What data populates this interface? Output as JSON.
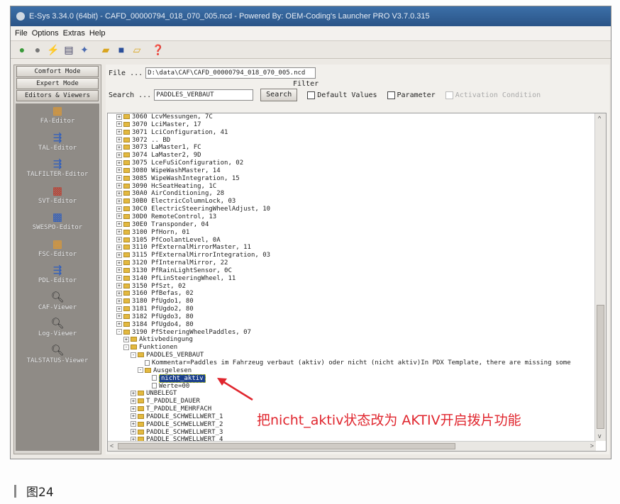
{
  "titlebar": {
    "text": "E-Sys 3.34.0  (64bit) - CAFD_00000794_018_070_005.ncd  - Powered By: OEM-Coding's Launcher PRO V3.7.0.315"
  },
  "menu": [
    "File",
    "Options",
    "Extras",
    "Help"
  ],
  "toolbar_icons": [
    "connect-icon",
    "disconnect-icon",
    "flash-icon",
    "document-icon",
    "settings-icon",
    "open-folder-icon",
    "save-icon",
    "export-icon",
    "help-icon"
  ],
  "sidebar": {
    "modes": [
      "Comfort Mode",
      "Expert Mode",
      "Editors & Viewers"
    ],
    "tools": [
      "FA-Editor",
      "TAL-Editor",
      "TALFILTER-Editor",
      "SVT-Editor",
      "SWESPO-Editor",
      "FSC-Editor",
      "PDL-Editor",
      "CAF-Viewer",
      "Log-Viewer",
      "TALSTATUS-Viewer"
    ]
  },
  "file": {
    "label": "File ...",
    "value": "D:\\data\\CAF\\CAFD_00000794_018_070_005.ncd"
  },
  "filter": {
    "label": "Filter"
  },
  "search": {
    "label": "Search ...",
    "value": "PADDLES_VERBAUT",
    "button": "Search",
    "default_values": "Default Values",
    "parameter": "Parameter",
    "activation_condition": "Activation Condition"
  },
  "tree": [
    {
      "indent": 0,
      "text": "3060 LcvMessungen, 7C",
      "type": "folder",
      "exp": "+"
    },
    {
      "indent": 0,
      "text": "3070 LciMaster, 17",
      "type": "folder",
      "exp": "+"
    },
    {
      "indent": 0,
      "text": "3071 LciConfiguration, 41",
      "type": "folder",
      "exp": "+"
    },
    {
      "indent": 0,
      "text": "3072 .. BD",
      "type": "folder",
      "exp": "+"
    },
    {
      "indent": 0,
      "text": "3073 LaMaster1, FC",
      "type": "folder",
      "exp": "+"
    },
    {
      "indent": 0,
      "text": "3074 LaMaster2, 9D",
      "type": "folder",
      "exp": "+"
    },
    {
      "indent": 0,
      "text": "3075 LceFuSiConfiguration, 02",
      "type": "folder",
      "exp": "+"
    },
    {
      "indent": 0,
      "text": "3080 WipeWashMaster, 14",
      "type": "folder",
      "exp": "+"
    },
    {
      "indent": 0,
      "text": "3085 WipeWashIntegration, 15",
      "type": "folder",
      "exp": "+"
    },
    {
      "indent": 0,
      "text": "3090 HcSeatHeating, 1C",
      "type": "folder",
      "exp": "+"
    },
    {
      "indent": 0,
      "text": "30A0 AirConditioning, 28",
      "type": "folder",
      "exp": "+"
    },
    {
      "indent": 0,
      "text": "30B0 ElectricColumnLock, 03",
      "type": "folder",
      "exp": "+"
    },
    {
      "indent": 0,
      "text": "30C0 ElectricSteeringWheelAdjust, 10",
      "type": "folder",
      "exp": "+"
    },
    {
      "indent": 0,
      "text": "30D0 RemoteControl, 13",
      "type": "folder",
      "exp": "+"
    },
    {
      "indent": 0,
      "text": "30E0 Transponder, 04",
      "type": "folder",
      "exp": "+"
    },
    {
      "indent": 0,
      "text": "3100 PfHorn, 01",
      "type": "folder",
      "exp": "+"
    },
    {
      "indent": 0,
      "text": "3105 PfCoolantLevel, 0A",
      "type": "folder",
      "exp": "+"
    },
    {
      "indent": 0,
      "text": "3110 PfExternalMirrorMaster, 11",
      "type": "folder",
      "exp": "+"
    },
    {
      "indent": 0,
      "text": "3115 PfExternalMirrorIntegration, 03",
      "type": "folder",
      "exp": "+"
    },
    {
      "indent": 0,
      "text": "3120 PfInternalMirror, 22",
      "type": "folder",
      "exp": "+"
    },
    {
      "indent": 0,
      "text": "3130 PfRainLightSensor, 0C",
      "type": "folder",
      "exp": "+"
    },
    {
      "indent": 0,
      "text": "3140 PfLinSteeringWheel, 11",
      "type": "folder",
      "exp": "+"
    },
    {
      "indent": 0,
      "text": "3150 PfSzt, 02",
      "type": "folder",
      "exp": "+"
    },
    {
      "indent": 0,
      "text": "3160 PfBefas, 02",
      "type": "folder",
      "exp": "+"
    },
    {
      "indent": 0,
      "text": "3180 PfUgdo1, 80",
      "type": "folder",
      "exp": "+"
    },
    {
      "indent": 0,
      "text": "3181 PfUgdo2, 80",
      "type": "folder",
      "exp": "+"
    },
    {
      "indent": 0,
      "text": "3182 PfUgdo3, 80",
      "type": "folder",
      "exp": "+"
    },
    {
      "indent": 0,
      "text": "3184 PfUgdo4, 80",
      "type": "folder",
      "exp": "+"
    },
    {
      "indent": 0,
      "text": "3190 PfSteeringWheelPaddles, 07",
      "type": "folder",
      "exp": "-"
    },
    {
      "indent": 1,
      "text": "Aktivbedingung",
      "type": "folder",
      "exp": "+"
    },
    {
      "indent": 1,
      "text": "Funktionen",
      "type": "folder",
      "exp": "-"
    },
    {
      "indent": 2,
      "text": "PADDLES_VERBAUT",
      "type": "folder",
      "exp": "-"
    },
    {
      "indent": 3,
      "text": "Kommentar=Paddles im Fahrzeug verbaut (aktiv) oder nicht (nicht aktiv)In PDX Template, there are missing some",
      "type": "leaf",
      "exp": ""
    },
    {
      "indent": 3,
      "text": "Ausgelesen",
      "type": "folder",
      "exp": "-"
    },
    {
      "indent": 4,
      "text": "nicht_aktiv",
      "type": "leaf",
      "exp": "",
      "selected": true
    },
    {
      "indent": 4,
      "text": "Werte=00",
      "type": "leaf",
      "exp": ""
    },
    {
      "indent": 2,
      "text": "UNBELEGT",
      "type": "folder",
      "exp": "+"
    },
    {
      "indent": 2,
      "text": "T_PADDLE_DAUER",
      "type": "folder",
      "exp": "+"
    },
    {
      "indent": 2,
      "text": "T_PADDLE_MEHRFACH",
      "type": "folder",
      "exp": "+"
    },
    {
      "indent": 2,
      "text": "PADDLE_SCHWELLWERT_1",
      "type": "folder",
      "exp": "+"
    },
    {
      "indent": 2,
      "text": "PADDLE_SCHWELLWERT_2",
      "type": "folder",
      "exp": "+"
    },
    {
      "indent": 2,
      "text": "PADDLE_SCHWELLWERT_3",
      "type": "folder",
      "exp": "+"
    },
    {
      "indent": 2,
      "text": "PADDLE_SCHWELLWERT_4",
      "type": "folder",
      "exp": "+"
    }
  ],
  "annotation": {
    "text": "把nicht_aktiv状态改为 AKTIV开启拨片功能",
    "color": "#e0262e"
  },
  "caption": {
    "text": "图24"
  }
}
